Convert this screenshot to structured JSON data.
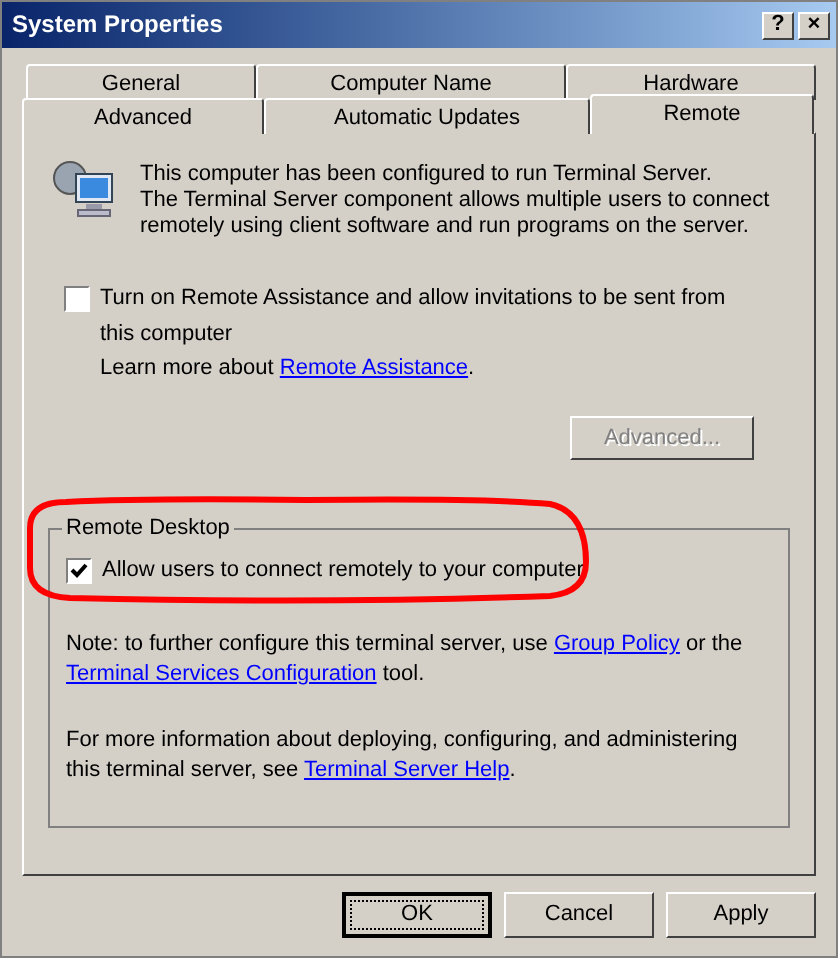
{
  "window": {
    "title": "System Properties",
    "buttons": [
      "?",
      "×"
    ]
  },
  "tab_rows": [
    [
      {
        "label": "General",
        "selected": false
      },
      {
        "label": "Computer Name",
        "selected": false
      },
      {
        "label": "Hardware",
        "selected": false
      }
    ],
    [
      {
        "label": "Advanced",
        "selected": false
      },
      {
        "label": "Automatic Updates",
        "selected": false
      },
      {
        "label": "Remote",
        "selected": true
      }
    ]
  ],
  "info": "This computer has been configured to run Terminal Server.\nThe Terminal Server component allows multiple users to connect remotely using client software and run programs on the server.",
  "remote_assistance": {
    "label": "Turn on Remote Assistance and allow invitations to be sent from this computer",
    "checked": false,
    "learn_more": [
      {
        "kind": "text",
        "text": "Learn more about "
      },
      {
        "kind": "link",
        "text": "Remote Assistance"
      },
      {
        "kind": "text",
        "text": "."
      }
    ],
    "advanced_button": {
      "label": "Advanced...",
      "disabled": true
    }
  },
  "remote_desktop": {
    "title": "Remote Desktop",
    "label": "Allow users to connect remotely to your computer",
    "checked": true,
    "paragraphs": [
      [
        {
          "kind": "text",
          "text": "Note: to further configure this terminal server, use "
        },
        {
          "kind": "link",
          "text": "Group Policy"
        },
        {
          "kind": "text",
          "text": " or the "
        },
        {
          "kind": "link",
          "text": "Terminal Services Configuration"
        },
        {
          "kind": "text",
          "text": " tool."
        }
      ],
      [
        {
          "kind": "text",
          "text": "For more information about deploying, configuring, and administering this terminal server, see "
        },
        {
          "kind": "link",
          "text": "Terminal Server Help"
        },
        {
          "kind": "text",
          "text": "."
        }
      ]
    ]
  },
  "buttons": [
    {
      "label": "OK",
      "default": true
    },
    {
      "label": "Cancel",
      "default": false
    },
    {
      "label": "Apply",
      "default": false
    }
  ]
}
